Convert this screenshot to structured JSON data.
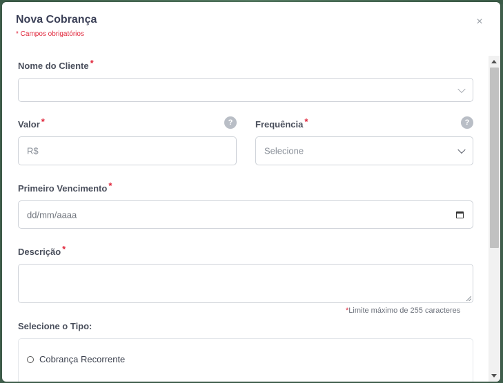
{
  "modal": {
    "title": "Nova Cobrança",
    "required_note": "* Campos obrigatórios",
    "close_symbol": "×"
  },
  "form": {
    "cliente": {
      "label": "Nome do Cliente",
      "required": "*",
      "value": ""
    },
    "valor": {
      "label": "Valor",
      "required": "*",
      "placeholder": "R$",
      "help": "?"
    },
    "frequencia": {
      "label": "Frequência",
      "required": "*",
      "selected": "Selecione",
      "help": "?"
    },
    "vencimento": {
      "label": "Primeiro Vencimento",
      "required": "*",
      "placeholder": "dd/mm/aaaa"
    },
    "descricao": {
      "label": "Descrição",
      "required": "*",
      "value": "",
      "limit_star": "*",
      "limit_text": "Limite máximo de 255 caracteres"
    },
    "tipo": {
      "label": "Selecione o Tipo:",
      "option_1": "Cobrança Recorrente"
    }
  },
  "colors": {
    "required": "#e0253a",
    "title": "#3a3f56",
    "border": "#ced2d8"
  }
}
